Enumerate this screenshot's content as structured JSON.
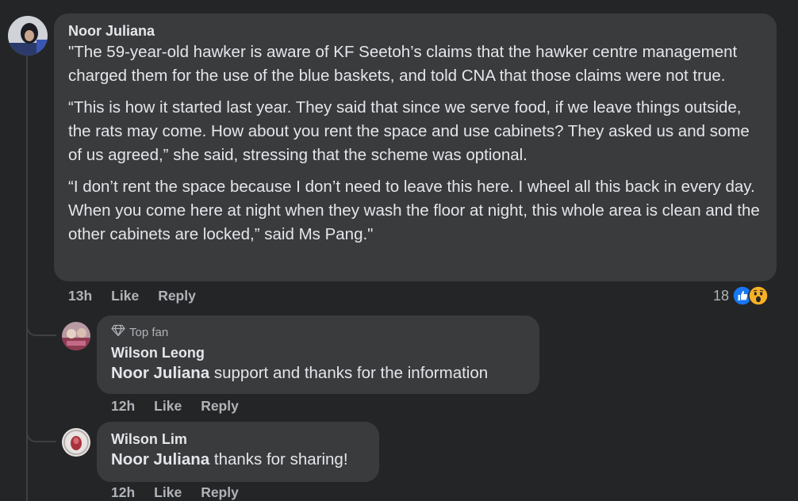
{
  "comments": [
    {
      "author": "Noor Juliana",
      "paragraphs": [
        "\"The 59-year-old hawker is aware of KF Seetoh’s claims that the hawker centre management charged them for the use of the blue baskets, and told CNA that those claims were not true.",
        "“This is how it started last year. They said that since we serve food, if we leave things outside, the rats may come. How about you rent the space and use cabinets? They asked us and some of us agreed,” she said, stressing that the scheme was optional.",
        "“I don’t rent the space because I don’t need to leave this here. I wheel all this back in every day. When you come here at night when they wash the floor at night, this whole area is clean and the other cabinets are locked,” said Ms Pang.\""
      ],
      "time": "13h",
      "like_label": "Like",
      "reply_label": "Reply",
      "reaction_count": "18",
      "reactions": [
        "like-reaction-icon",
        "wow-reaction-icon"
      ]
    }
  ],
  "replies": [
    {
      "badge": "Top fan",
      "badge_icon": "diamond-icon",
      "author": "Wilson Leong",
      "mention": "Noor Juliana",
      "text": " support and thanks for the information",
      "time": "12h",
      "like_label": "Like",
      "reply_label": "Reply"
    },
    {
      "author": "Wilson Lim",
      "mention": "Noor Juliana",
      "text": " thanks for sharing!",
      "time": "12h",
      "like_label": "Like",
      "reply_label": "Reply"
    }
  ],
  "colors": {
    "background": "#242526",
    "bubble": "#3a3b3c",
    "primary_text": "#e4e6eb",
    "secondary_text": "#b0b3b8",
    "like_blue": "#1877f2",
    "wow_yellow": "#f7b125"
  }
}
